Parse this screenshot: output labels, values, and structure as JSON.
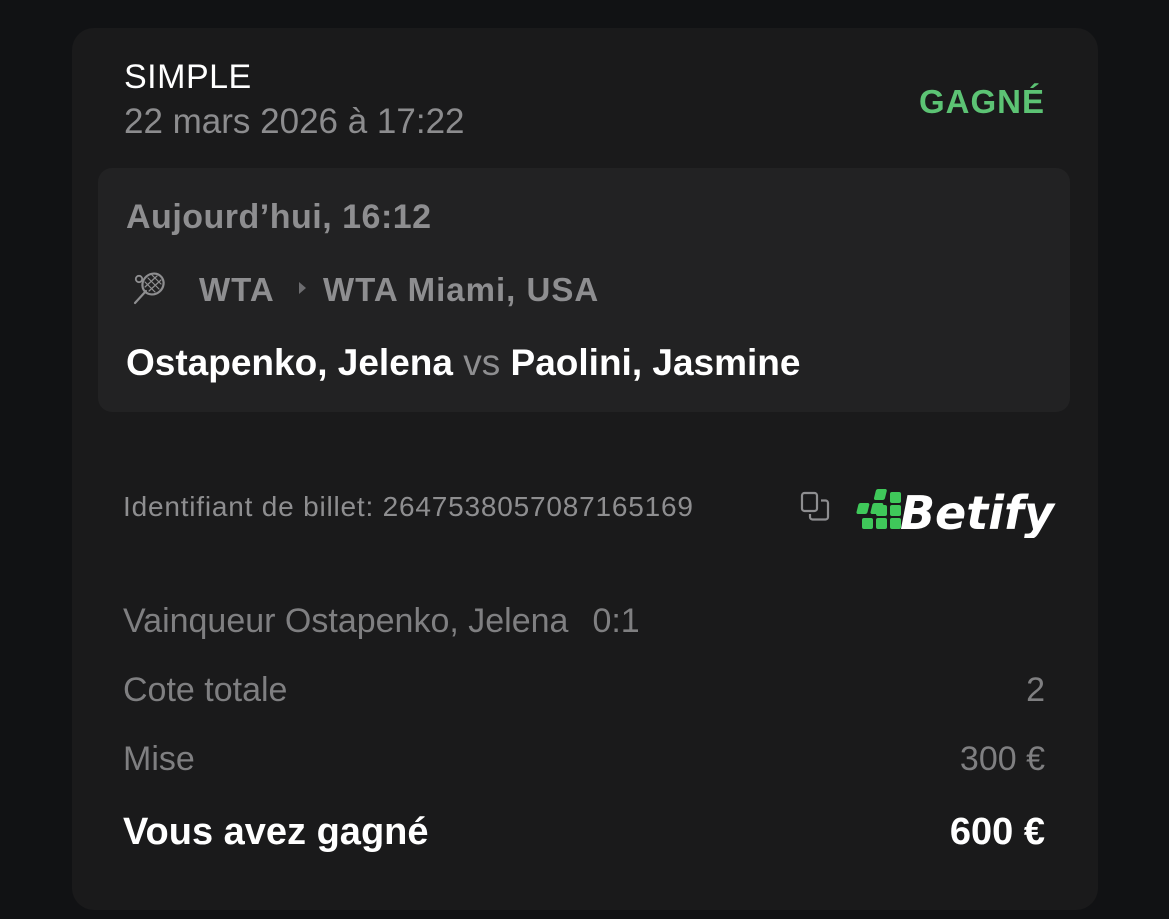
{
  "bet": {
    "type": "SIMPLE",
    "placed_at": "22 mars 2026 à 17:22",
    "status": "GAGNÉ"
  },
  "event": {
    "time": "Aujourd’hui, 16:12",
    "sport": "WTA",
    "tournament": "WTA Miami, USA",
    "player1": "Ostapenko, Jelena",
    "vs": "vs",
    "player2": "Paolini, Jasmine",
    "sport_icon": "tennis-racket-icon"
  },
  "ticket": {
    "label": "Identifiant de billet: 264753805708716516​9",
    "copy_icon": "copy-icon"
  },
  "brand": {
    "name": "Betify",
    "accent_color": "#3fc85a"
  },
  "summary": {
    "pick_label": "Vainqueur Ostapenko, Jelena",
    "pick_score": "0:1",
    "odds_label": "Cote totale",
    "odds_value": "2",
    "stake_label": "Mise",
    "stake_value": "300 €",
    "win_label": "Vous avez gagné",
    "win_value": "600 €"
  },
  "colors": {
    "status_won": "#5cc374",
    "card_bg": "#1a1a1b",
    "event_bg": "#222223"
  }
}
